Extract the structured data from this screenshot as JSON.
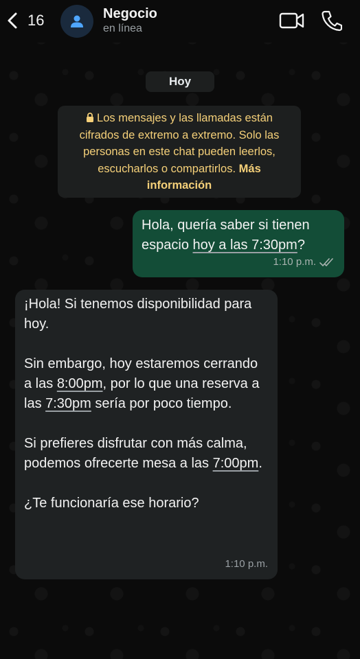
{
  "header": {
    "back_count": "16",
    "contact_name": "Negocio",
    "contact_status": "en línea"
  },
  "date_chip": "Hoy",
  "encryption_notice": {
    "text": "Los mensajes y las llamadas están cifrados de extremo a extremo. Solo las personas en este chat pueden leerlos, escucharlos o compartirlos.",
    "link": "Más información",
    "color": "#f5d079"
  },
  "messages": [
    {
      "direction": "outgoing",
      "text_pre": "Hola, quería saber si tienen espacio ",
      "text_link": "hoy a las 7:30pm",
      "text_post": "?",
      "time": "1:10 p.m.",
      "read": true,
      "bubble_color": "#134d37"
    },
    {
      "direction": "incoming",
      "p1": "¡Hola! Si tenemos disponibilidad para hoy.",
      "p2_a": "Sin embargo, hoy estaremos cerrando a las ",
      "p2_l1": "8:00pm",
      "p2_b": ", por lo que una reserva a las ",
      "p2_l2": "7:30pm",
      "p2_c": " sería por poco tiempo.",
      "p3_a": "Si prefieres disfrutar con más calma, podemos ofrecerte mesa a las ",
      "p3_l": "7:00pm",
      "p3_b": ".",
      "p4": "¿Te funcionaría ese horario?",
      "time": "1:10 p.m.",
      "bubble_color": "#1f2223"
    }
  ],
  "icons": {
    "back": "chevron-left-icon",
    "avatar": "person-icon",
    "video": "video-camera-icon",
    "call": "phone-icon",
    "lock": "lock-icon",
    "read_receipt": "double-check-icon"
  }
}
